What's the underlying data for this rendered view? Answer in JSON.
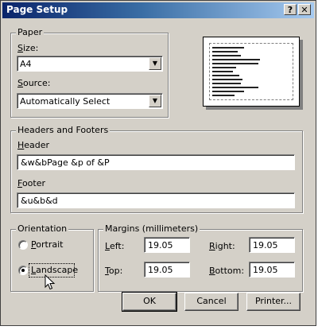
{
  "window": {
    "title": "Page Setup",
    "help_label": "?",
    "close_label": "✕"
  },
  "paper": {
    "legend": "Paper",
    "size_label": "Size:",
    "size_value": "A4",
    "source_label": "Source:",
    "source_value": "Automatically Select"
  },
  "headers_footers": {
    "legend": "Headers and Footers",
    "header_label": "Header",
    "header_value": "&w&bPage &p of &P",
    "footer_label": "Footer",
    "footer_value": "&u&b&d"
  },
  "orientation": {
    "legend": "Orientation",
    "portrait_label": "Portrait",
    "landscape_label": "Landscape",
    "selected": "landscape"
  },
  "margins": {
    "legend": "Margins (millimeters)",
    "left_label": "Left:",
    "left_value": "19.05",
    "right_label": "Right:",
    "right_value": "19.05",
    "top_label": "Top:",
    "top_value": "19.05",
    "bottom_label": "Bottom:",
    "bottom_value": "19.05"
  },
  "buttons": {
    "ok": "OK",
    "cancel": "Cancel",
    "printer": "Printer..."
  },
  "icons": {
    "dropdown": "chevron-down-icon",
    "cursor": "mouse-pointer-icon"
  }
}
